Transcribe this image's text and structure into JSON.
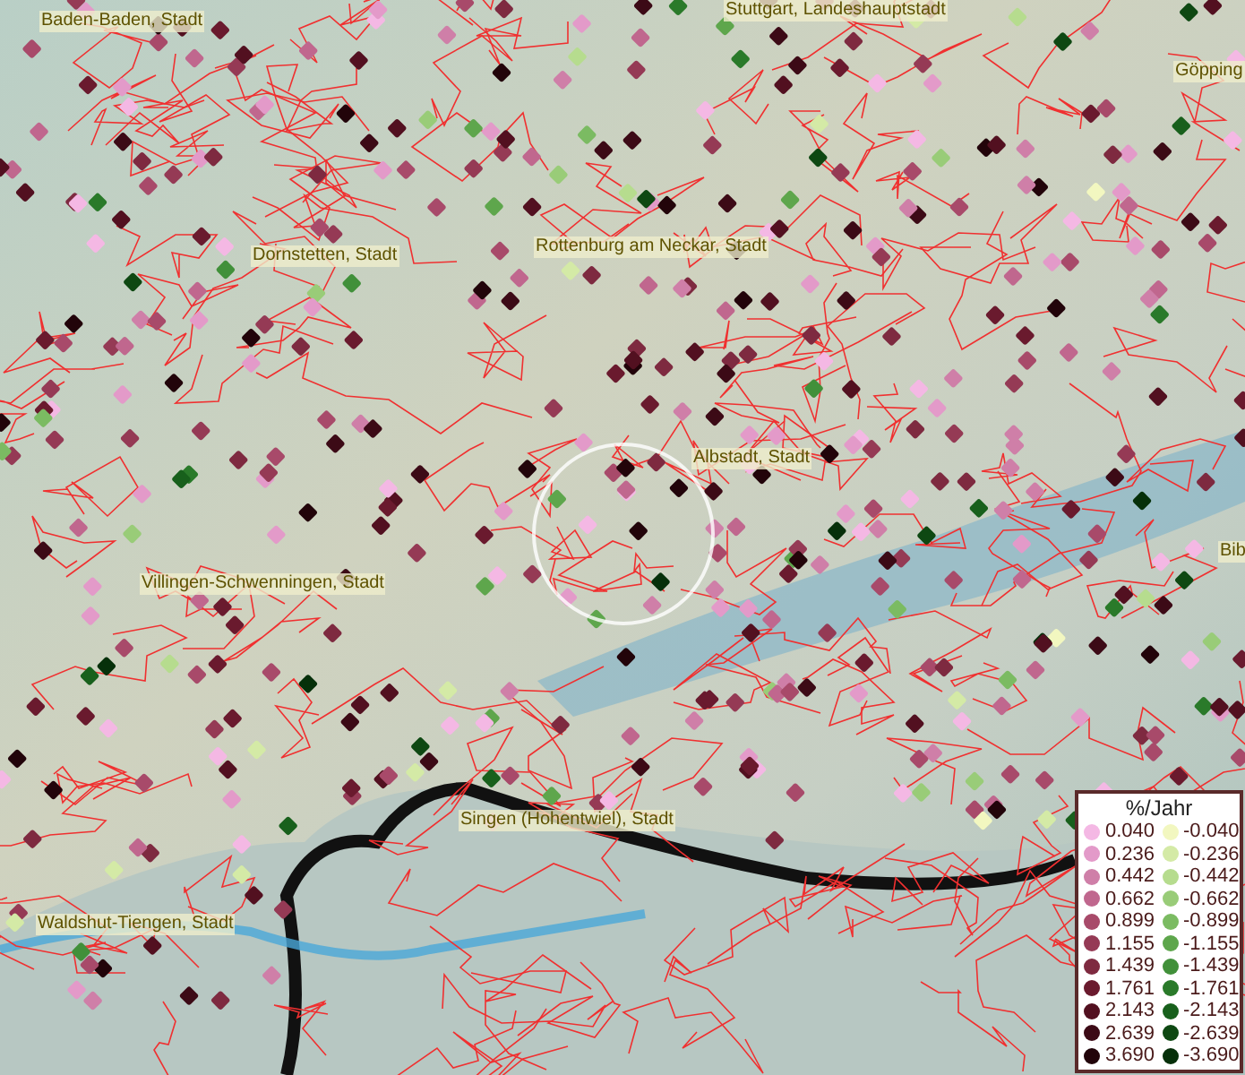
{
  "map": {
    "place_labels": [
      "Baden-Baden, Stadt",
      "Stuttgart, Landeshauptstadt",
      "Göpping",
      "Dornstetten, Stadt",
      "Rottenburg am Neckar, Stadt",
      "Albstadt, Stadt",
      "Villingen-Schwenningen, Stadt",
      "Bib",
      "Singen (Hohentwiel), Stadt",
      "Waldshut-Tiengen, Stadt"
    ]
  },
  "legend": {
    "title": "%/Jahr",
    "items": [
      {
        "label": "0.040",
        "color": "#f4b8e4"
      },
      {
        "label": "-0.040",
        "color": "#f2f7c0"
      },
      {
        "label": "0.236",
        "color": "#e39ac9"
      },
      {
        "label": "-0.236",
        "color": "#d4eaa6"
      },
      {
        "label": "0.442",
        "color": "#cf7fa8"
      },
      {
        "label": "-0.442",
        "color": "#b6dc8e"
      },
      {
        "label": "0.662",
        "color": "#c0678e"
      },
      {
        "label": "-0.662",
        "color": "#99cc78"
      },
      {
        "label": "0.899",
        "color": "#a84a6a"
      },
      {
        "label": "-0.899",
        "color": "#7bbb62"
      },
      {
        "label": "1.155",
        "color": "#953a55"
      },
      {
        "label": "-1.155",
        "color": "#5ea64c"
      },
      {
        "label": "1.439",
        "color": "#7e2a40"
      },
      {
        "label": "-1.439",
        "color": "#41903a"
      },
      {
        "label": "1.761",
        "color": "#6a1a2e"
      },
      {
        "label": "-1.761",
        "color": "#2a7a2a"
      },
      {
        "label": "2.143",
        "color": "#521020"
      },
      {
        "label": "-2.143",
        "color": "#18601c"
      },
      {
        "label": "2.639",
        "color": "#3c0a16"
      },
      {
        "label": "-2.639",
        "color": "#0e4812"
      },
      {
        "label": "3.690",
        "color": "#22040a"
      },
      {
        "label": "-3.690",
        "color": "#06300a"
      }
    ]
  }
}
